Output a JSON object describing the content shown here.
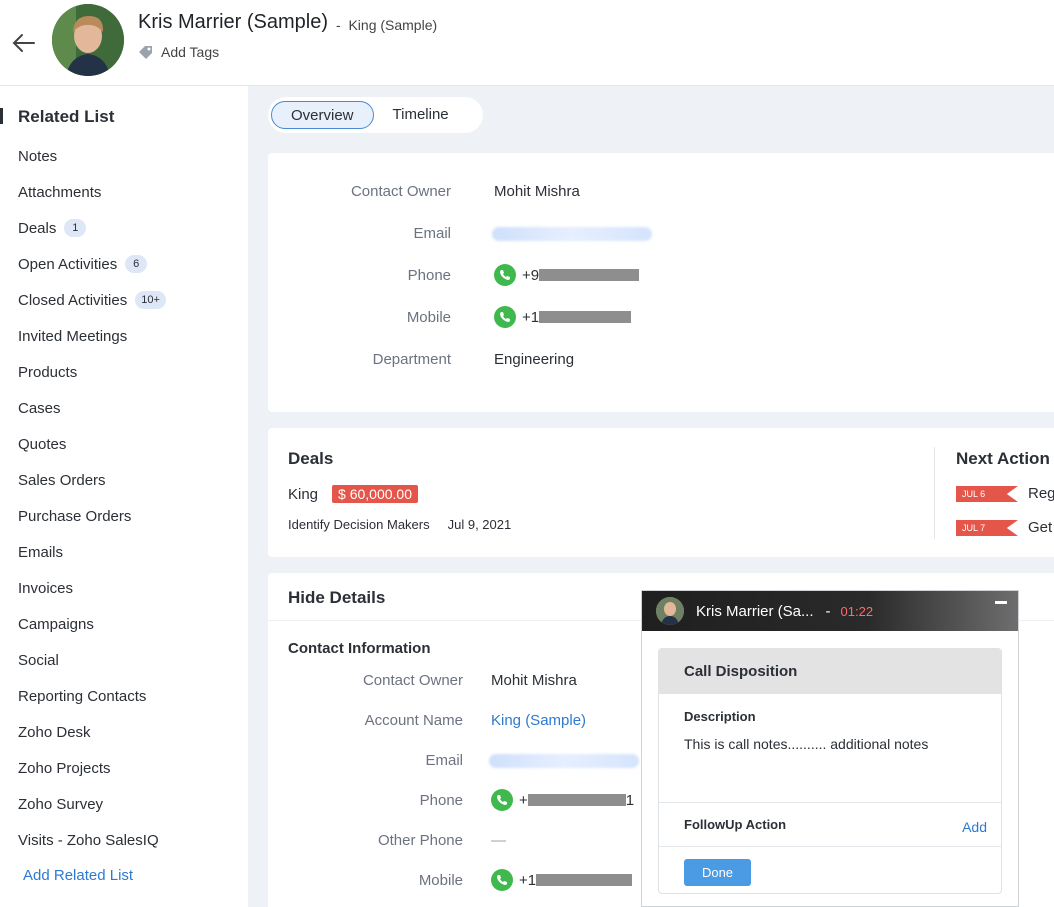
{
  "header": {
    "name": "Kris Marrier (Sample)",
    "separator": "-",
    "account": "King (Sample)",
    "add_tags": "Add Tags"
  },
  "tabs": [
    {
      "label": "Overview",
      "active": true
    },
    {
      "label": "Timeline",
      "active": false
    }
  ],
  "sidebar": {
    "title": "Related List",
    "items": [
      {
        "label": "Notes",
        "badge": ""
      },
      {
        "label": "Attachments",
        "badge": ""
      },
      {
        "label": "Deals",
        "badge": "1"
      },
      {
        "label": "Open Activities",
        "badge": "6"
      },
      {
        "label": "Closed Activities",
        "badge": "10+"
      },
      {
        "label": "Invited Meetings",
        "badge": ""
      },
      {
        "label": "Products",
        "badge": ""
      },
      {
        "label": "Cases",
        "badge": ""
      },
      {
        "label": "Quotes",
        "badge": ""
      },
      {
        "label": "Sales Orders",
        "badge": ""
      },
      {
        "label": "Purchase Orders",
        "badge": ""
      },
      {
        "label": "Emails",
        "badge": ""
      },
      {
        "label": "Invoices",
        "badge": ""
      },
      {
        "label": "Campaigns",
        "badge": ""
      },
      {
        "label": "Social",
        "badge": ""
      },
      {
        "label": "Reporting Contacts",
        "badge": ""
      },
      {
        "label": "Zoho Desk",
        "badge": ""
      },
      {
        "label": "Zoho Projects",
        "badge": ""
      },
      {
        "label": "Zoho Survey",
        "badge": ""
      },
      {
        "label": "Visits - Zoho SalesIQ",
        "badge": ""
      }
    ],
    "add_related": "Add Related List"
  },
  "overview": {
    "contact_owner_label": "Contact Owner",
    "contact_owner": "Mohit Mishra",
    "email_label": "Email",
    "phone_label": "Phone",
    "phone_prefix": "+9",
    "mobile_label": "Mobile",
    "mobile_prefix": "+1",
    "department_label": "Department",
    "department": "Engineering"
  },
  "deals": {
    "title": "Deals",
    "deal_name": "King",
    "amount": "$ 60,000.00",
    "stage": "Identify Decision Makers",
    "date": "Jul 9, 2021",
    "next_action_title": "Next Action",
    "actions": [
      {
        "date": "JUL 6",
        "text": "Regi"
      },
      {
        "date": "JUL 7",
        "text": "Get"
      }
    ]
  },
  "details": {
    "hide_label": "Hide Details",
    "section_title": "Contact Information",
    "contact_owner_label": "Contact Owner",
    "contact_owner": "Mohit Mishra",
    "account_name_label": "Account Name",
    "account_name": "King (Sample)",
    "email_label": "Email",
    "phone_label": "Phone",
    "phone_prefix": "+",
    "phone_suffix": "1",
    "other_phone_label": "Other Phone",
    "other_phone": "—",
    "mobile_label": "Mobile",
    "mobile_prefix": "+1"
  },
  "call_popup": {
    "caller": "Kris Marrier (Sa...",
    "separator": "-",
    "timer": "01:22",
    "disposition_title": "Call Disposition",
    "description_label": "Description",
    "description": "This is call notes.......... additional notes",
    "followup_label": "FollowUp Action",
    "add_label": "Add",
    "done_label": "Done"
  },
  "colors": {
    "accent": "#2e7ad0",
    "danger": "#e4564a",
    "call_green": "#3fb94e"
  }
}
